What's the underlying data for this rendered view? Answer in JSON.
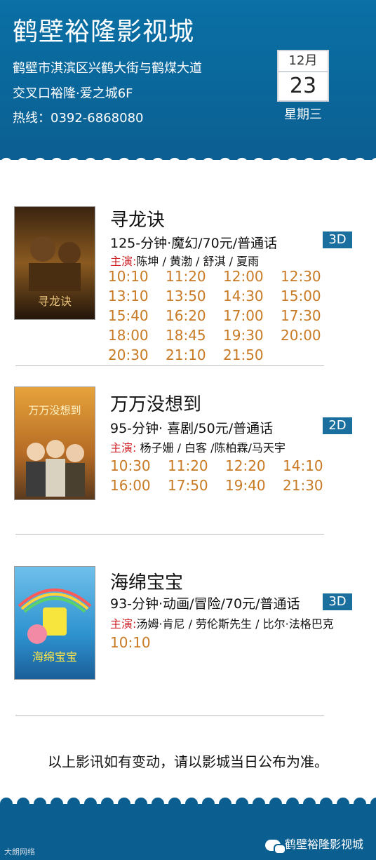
{
  "header": {
    "title": "鹤壁裕隆影视城",
    "address_line1": "鹤壁市淇滨区兴鹤大街与鹤煤大道",
    "address_line2": "交叉口裕隆·爱之城6F",
    "hotline": "热线：0392-6868080"
  },
  "calendar": {
    "month": "12月",
    "day": "23",
    "weekday": "星期三"
  },
  "movies": [
    {
      "title": "寻龙诀",
      "info": "125-分钟·魔幻/70元/普通话",
      "format": "3D",
      "cast_label": "主演:",
      "cast": "陈坤 / 黄渤 / 舒淇 / 夏雨",
      "times": [
        "10:10",
        "11:20",
        "12:00",
        "12:30",
        "13:10",
        "13:50",
        "14:30",
        "15:00",
        "15:40",
        "16:20",
        "17:00",
        "17:30",
        "18:00",
        "18:45",
        "19:30",
        "20:00",
        "20:30",
        "21:10",
        "21:50"
      ]
    },
    {
      "title": "万万没想到",
      "info": "95-分钟· 喜剧/50元/普通话",
      "format": "2D",
      "cast_label": "主演:",
      "cast": " 杨子姗 / 白客 /陈柏霖/马天宇",
      "times": [
        "10:30",
        "11:20",
        "12:20",
        "14:10",
        "16:00",
        "17:50",
        "19:40",
        "21:30"
      ]
    },
    {
      "title": "海绵宝宝",
      "info": "93-分钟·动画/冒险/70元/普通话",
      "format": "3D",
      "cast_label": "主演:",
      "cast": "汤姆·肯尼 / 劳伦斯先生 / 比尔·法格巴克",
      "times": [
        "10:10"
      ]
    }
  ],
  "notice": "以上影讯如有变动，请以影城当日公布为准。",
  "footer": {
    "brand": "鹤壁裕隆影视城",
    "watermark": "大朗网络"
  },
  "colors": {
    "header_blue": "#0b6aa0",
    "time_orange": "#c87a24",
    "cast_red": "#d2232a",
    "badge_blue": "#1a6f9f"
  }
}
